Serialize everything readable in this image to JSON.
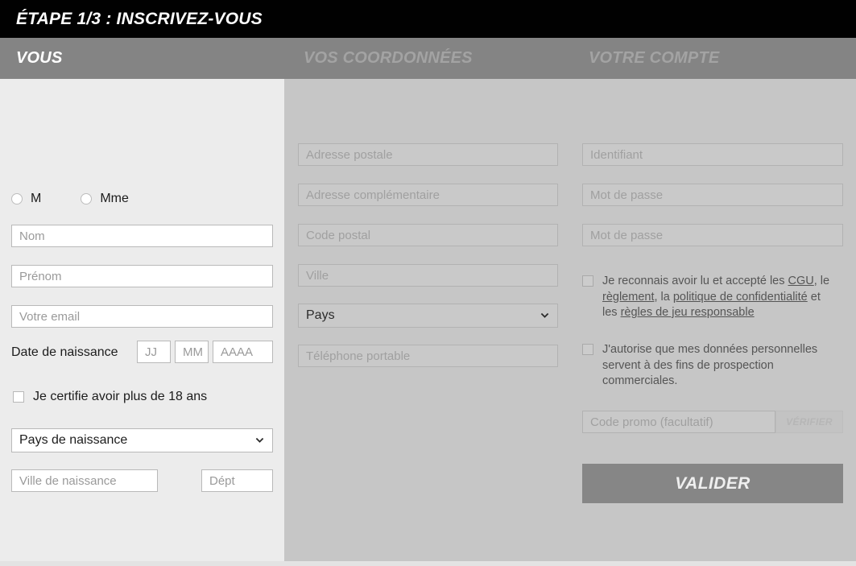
{
  "header": {
    "step_title": "ÉTAPE 1/3 : INSCRIVEZ-VOUS"
  },
  "tabs": [
    {
      "label": "VOUS",
      "active": true
    },
    {
      "label": "VOS COORDONNÉES",
      "active": false
    },
    {
      "label": "VOTRE COMPTE",
      "active": false
    }
  ],
  "colors": {
    "titlebar_bg": "#010101",
    "tabband_bg": "#848484",
    "active_col_bg": "#ececec",
    "disabled_col_bg": "#c6c6c6",
    "validate_bg": "#868686",
    "active_tab_text": "#ffffff",
    "dim_tab_text": "#a3a3a3"
  },
  "column_vous": {
    "gender": {
      "options": [
        {
          "label": "M",
          "checked": false
        },
        {
          "label": "Mme",
          "checked": false
        }
      ]
    },
    "nom": {
      "placeholder": "Nom",
      "value": ""
    },
    "prenom": {
      "placeholder": "Prénom",
      "value": ""
    },
    "email": {
      "placeholder": "Votre email",
      "value": ""
    },
    "dob_label": "Date de naissance",
    "dob_day": {
      "placeholder": "JJ",
      "value": ""
    },
    "dob_month": {
      "placeholder": "MM",
      "value": ""
    },
    "dob_year": {
      "placeholder": "AAAA",
      "value": ""
    },
    "age_check": {
      "label": "Je certifie avoir plus de 18 ans",
      "checked": false
    },
    "birth_country": {
      "value": "Pays de naissance"
    },
    "birth_city": {
      "placeholder": "Ville de naissance",
      "value": ""
    },
    "birth_dept": {
      "placeholder": "Dépt",
      "value": ""
    }
  },
  "column_coordonnees": {
    "adresse": {
      "placeholder": "Adresse postale",
      "value": ""
    },
    "adresse_comp": {
      "placeholder": "Adresse complémentaire",
      "value": ""
    },
    "code_postal": {
      "placeholder": "Code postal",
      "value": ""
    },
    "ville": {
      "placeholder": "Ville",
      "value": ""
    },
    "pays": {
      "value": "Pays"
    },
    "telephone": {
      "placeholder": "Téléphone portable",
      "value": ""
    }
  },
  "column_compte": {
    "identifiant": {
      "placeholder": "Identifiant",
      "value": ""
    },
    "password": {
      "placeholder": "Mot de passe",
      "value": ""
    },
    "password_confirm": {
      "placeholder": "Mot de passe",
      "value": ""
    },
    "terms": {
      "checked": false,
      "text_1": "Je reconnais avoir lu et accepté les ",
      "link_cgu": "CGU",
      "text_2": ", le ",
      "link_reglement": "règlement",
      "text_3": ", la ",
      "link_privacy": "politique de confidentialité",
      "text_4": " et les ",
      "link_rules": "règles de jeu responsable"
    },
    "marketing": {
      "checked": false,
      "text": "J'autorise que mes données personnelles servent à des fins de prospection commerciales."
    },
    "promo": {
      "placeholder": "Code promo (facultatif)",
      "value": ""
    },
    "verify_label": "VÉRIFIER",
    "validate_label": "VALIDER"
  }
}
